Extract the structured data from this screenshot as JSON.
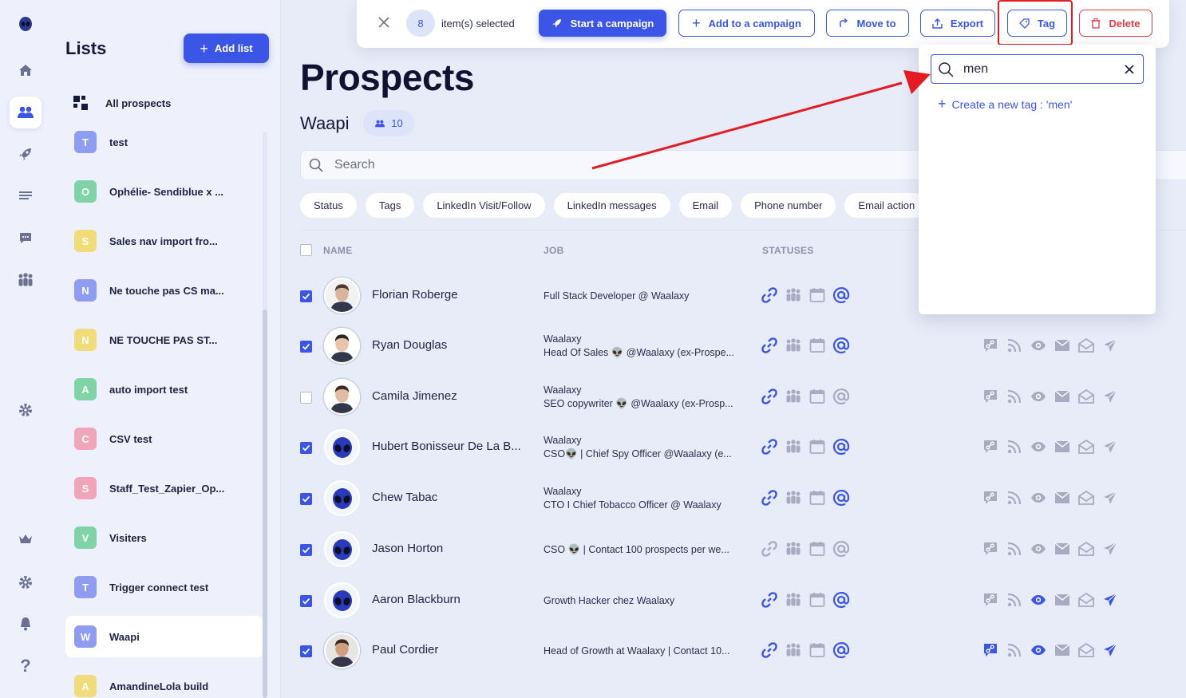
{
  "rail": {
    "icons": [
      "alien-logo-icon",
      "home-icon",
      "users-icon",
      "rocket-icon",
      "list-icon",
      "chat-icon",
      "team-icon",
      "settings-icon",
      "crown-icon",
      "gear-icon",
      "bell-icon",
      "help-icon"
    ]
  },
  "lists": {
    "title": "Lists",
    "add_label": "Add list",
    "all_label": "All prospects",
    "items": [
      {
        "letter": "T",
        "name": "test",
        "color": "#8e9cf2"
      },
      {
        "letter": "O",
        "name": "Ophélie- Sendiblue x ...",
        "color": "#7fd3a6"
      },
      {
        "letter": "S",
        "name": "Sales nav import fro...",
        "color": "#f1dc7a"
      },
      {
        "letter": "N",
        "name": "Ne touche pas CS ma...",
        "color": "#8e9cf2"
      },
      {
        "letter": "N",
        "name": "NE TOUCHE PAS ST...",
        "color": "#f1dc7a"
      },
      {
        "letter": "A",
        "name": "auto import test",
        "color": "#7fd3a6"
      },
      {
        "letter": "C",
        "name": "CSV test",
        "color": "#f0a6b8"
      },
      {
        "letter": "S",
        "name": "Staff_Test_Zapier_Op...",
        "color": "#f0a6b8"
      },
      {
        "letter": "V",
        "name": "Visiters",
        "color": "#7fd3a6"
      },
      {
        "letter": "T",
        "name": "Trigger connect test",
        "color": "#8e9cf2"
      },
      {
        "letter": "W",
        "name": "Waapi",
        "color": "#8e9cf2"
      },
      {
        "letter": "A",
        "name": "AmandineLola build",
        "color": "#f1dc7a"
      }
    ]
  },
  "actionbar": {
    "count": "8",
    "selected_label": "item(s) selected",
    "start_campaign": "Start a campaign",
    "add_campaign": "Add to a campaign",
    "move_to": "Move to",
    "export": "Export",
    "tag": "Tag",
    "delete": "Delete"
  },
  "tag_popup": {
    "query": "men",
    "create_label": "Create a new tag : 'men'"
  },
  "main": {
    "title": "Prospects",
    "list_name": "Waapi",
    "list_count": "10",
    "search_placeholder": "Search",
    "filters": [
      "Status",
      "Tags",
      "LinkedIn Visit/Follow",
      "LinkedIn messages",
      "Email",
      "Phone number",
      "Email action"
    ],
    "columns": {
      "name": "NAME",
      "job": "JOB",
      "statuses": "STATUSES"
    }
  },
  "rows": [
    {
      "name": "Florian Roberge",
      "job": [
        "Full Stack Developer @ Waalaxy"
      ],
      "checked": true,
      "avatar": "photo",
      "status_active": [
        true,
        false,
        false,
        true
      ],
      "actions": false
    },
    {
      "name": "Ryan Douglas",
      "job": [
        "Waalaxy",
        "Head Of Sales 👽 @Waalaxy (ex-Prospe..."
      ],
      "checked": true,
      "avatar": "photo",
      "status_active": [
        true,
        false,
        false,
        true
      ],
      "actions": true
    },
    {
      "name": "Camila Jimenez",
      "job": [
        "Waalaxy",
        "SEO copywriter 👽 @Waalaxy (ex-Prosp..."
      ],
      "checked": false,
      "avatar": "photo",
      "status_active": [
        true,
        false,
        false,
        false
      ],
      "actions": true
    },
    {
      "name": "Hubert Bonisseur De La B...",
      "job": [
        "Waalaxy",
        "CSO👽 | Chief Spy Officer @Waalaxy (e..."
      ],
      "checked": true,
      "avatar": "alien",
      "status_active": [
        true,
        false,
        false,
        true
      ],
      "actions": true
    },
    {
      "name": "Chew Tabac",
      "job": [
        "Waalaxy",
        "CTO I Chief Tobacco Officer @ Waalaxy"
      ],
      "checked": true,
      "avatar": "alien",
      "status_active": [
        true,
        false,
        false,
        true
      ],
      "actions": true
    },
    {
      "name": "Jason Horton",
      "job": [
        "CSO 👽 | Contact 100 prospects per we..."
      ],
      "checked": true,
      "avatar": "alien",
      "status_active": [
        false,
        false,
        false,
        false
      ],
      "actions": true
    },
    {
      "name": "Aaron Blackburn",
      "job": [
        "Growth Hacker chez Waalaxy"
      ],
      "checked": true,
      "avatar": "alien",
      "status_active": [
        true,
        false,
        false,
        true
      ],
      "actions": true,
      "actions_active": [
        false,
        false,
        true,
        false,
        false,
        true
      ]
    },
    {
      "name": "Paul Cordier",
      "job": [
        "Head of Growth at Waalaxy | Contact 10..."
      ],
      "checked": true,
      "avatar": "photo",
      "status_active": [
        true,
        false,
        false,
        true
      ],
      "actions": true,
      "actions_active": [
        true,
        false,
        true,
        false,
        false,
        true
      ]
    }
  ],
  "colors": {
    "accent": "#3b55e6",
    "danger": "#e03b4a",
    "annotation": "#e31b23",
    "muted_icon": "#a7acc2"
  }
}
